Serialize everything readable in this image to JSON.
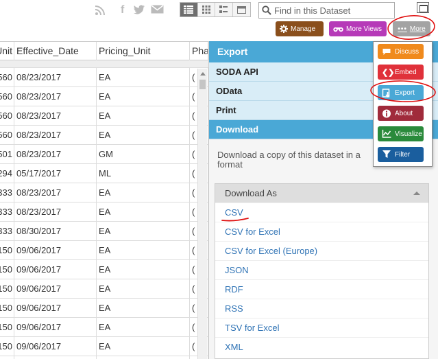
{
  "search": {
    "placeholder": "Find in this Dataset"
  },
  "toolbar": {
    "manage_label": "Manage",
    "more_views_label": "More Views",
    "more_label": "More"
  },
  "table": {
    "headers": [
      "Unit",
      "Effective_Date",
      "Pricing_Unit",
      "Pha"
    ],
    "rows": [
      [
        "560",
        "08/23/2017",
        "EA",
        "("
      ],
      [
        "560",
        "08/23/2017",
        "EA",
        "("
      ],
      [
        "560",
        "08/23/2017",
        "EA",
        "("
      ],
      [
        "560",
        "08/23/2017",
        "EA",
        "("
      ],
      [
        "501",
        "08/23/2017",
        "GM",
        "("
      ],
      [
        "294",
        "05/17/2017",
        "ML",
        "("
      ],
      [
        "333",
        "08/23/2017",
        "EA",
        "("
      ],
      [
        "333",
        "08/23/2017",
        "EA",
        "("
      ],
      [
        "333",
        "08/30/2017",
        "EA",
        "("
      ],
      [
        "150",
        "09/06/2017",
        "EA",
        "("
      ],
      [
        "150",
        "09/06/2017",
        "EA",
        "("
      ],
      [
        "150",
        "09/06/2017",
        "EA",
        "("
      ],
      [
        "150",
        "09/06/2017",
        "EA",
        "("
      ],
      [
        "150",
        "09/06/2017",
        "EA",
        "("
      ],
      [
        "150",
        "09/06/2017",
        "EA",
        "("
      ],
      [
        "150",
        "09/06/2017",
        "EA",
        "("
      ]
    ]
  },
  "export_panel": {
    "title": "Export",
    "sections": [
      "SODA API",
      "OData",
      "Print",
      "Download"
    ],
    "download_text": "Download a copy of this dataset in a format",
    "download_as_label": "Download As",
    "formats": [
      "CSV",
      "CSV for Excel",
      "CSV for Excel (Europe)",
      "JSON",
      "RDF",
      "RSS",
      "TSV for Excel",
      "XML"
    ]
  },
  "more_menu": {
    "items": [
      "Discuss",
      "Embed",
      "Export",
      "About",
      "Visualize",
      "Filter"
    ]
  },
  "colors": {
    "panel_blue": "#4aa8d6",
    "manage": "#8a4f1c",
    "more_views": "#b63ab8",
    "more": "#a3a3a3",
    "discuss": "#f08a1c",
    "embed": "#e0313a",
    "about": "#a02b3b",
    "visualize": "#2a8a3b",
    "filter": "#1a5e9e",
    "link": "#2f73b5",
    "annotation": "#e01010"
  }
}
